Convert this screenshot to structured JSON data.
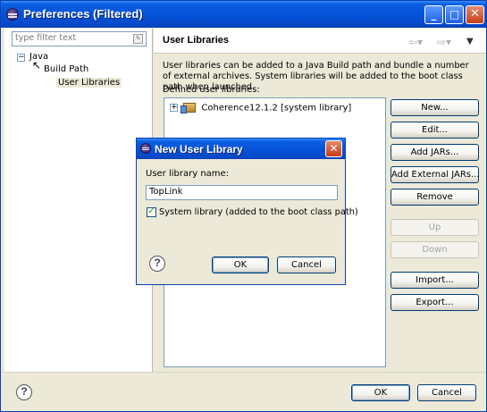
{
  "window": {
    "title": "Preferences (Filtered)"
  },
  "left": {
    "filter_placeholder": "type filter text",
    "tree": [
      {
        "label": "Java",
        "expander": "⊟"
      },
      {
        "label": "Build Path",
        "expander": "⊟"
      },
      {
        "label": "User Libraries"
      }
    ]
  },
  "right": {
    "title": "User Libraries",
    "description": "User libraries can be added to a Java Build path and bundle a number of external archives. System libraries will be added to the boot class path when launched.",
    "defined_label": "Defined user libraries:",
    "libraries": [
      {
        "label": "Coherence12.1.2 [system library]",
        "expander": "+"
      }
    ],
    "buttons": {
      "new": "New...",
      "edit": "Edit...",
      "add_jars": "Add JARs...",
      "add_external_jars": "Add External JARs...",
      "remove": "Remove",
      "up": "Up",
      "down": "Down",
      "import": "Import...",
      "export": "Export..."
    }
  },
  "bottom": {
    "ok": "OK",
    "cancel": "Cancel",
    "help": "?"
  },
  "dialog": {
    "title": "New User Library",
    "name_label": "User library name:",
    "name_value": "TopLink",
    "system_checkbox_label": "System library (added to the boot class path)",
    "system_checked": true,
    "ok": "OK",
    "cancel": "Cancel",
    "help": "?"
  },
  "colors": {
    "titlebar": "#0553d8",
    "window_bg": "#ece9d8",
    "accent_border": "#003c74"
  }
}
